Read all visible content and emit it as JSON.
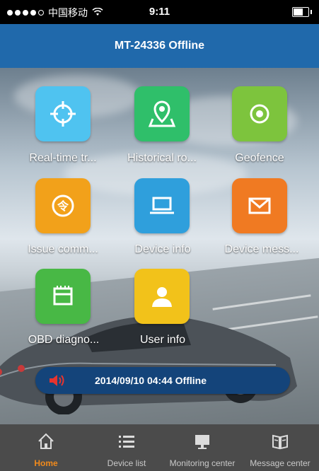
{
  "status_bar": {
    "carrier": "中国移动",
    "time": "9:11"
  },
  "header": {
    "title": "MT-24336 Offline"
  },
  "grid": [
    {
      "label": "Real-time tr...",
      "icon": "crosshair-icon",
      "color": "#4fc3f0"
    },
    {
      "label": "Historical ro...",
      "icon": "map-pin-icon",
      "color": "#2fbf6a"
    },
    {
      "label": "Geofence",
      "icon": "target-icon",
      "color": "#7dc43d"
    },
    {
      "label": "Issue comm...",
      "icon": "command-icon",
      "color": "#f2a11a"
    },
    {
      "label": "Device info",
      "icon": "laptop-icon",
      "color": "#2f9fdc"
    },
    {
      "label": "Device mess...",
      "icon": "envelope-icon",
      "color": "#f07a22"
    },
    {
      "label": "OBD diagno...",
      "icon": "obd-icon",
      "color": "#48b845"
    },
    {
      "label": "User info",
      "icon": "user-icon",
      "color": "#f2c21a"
    }
  ],
  "notification": {
    "text": "2014/09/10 04:44 Offline",
    "icon": "speaker-icon"
  },
  "tabbar": [
    {
      "label": "Home",
      "icon": "home-icon",
      "active": true
    },
    {
      "label": "Device list",
      "icon": "list-icon",
      "active": false
    },
    {
      "label": "Monitoring center",
      "icon": "monitor-icon",
      "active": false
    },
    {
      "label": "Message center",
      "icon": "book-icon",
      "active": false
    }
  ],
  "colors": {
    "header_bg": "#2069ab",
    "tabbar_bg": "#4b4b4b",
    "active_tab": "#f08a1c",
    "pill_bg": "#14447a"
  }
}
